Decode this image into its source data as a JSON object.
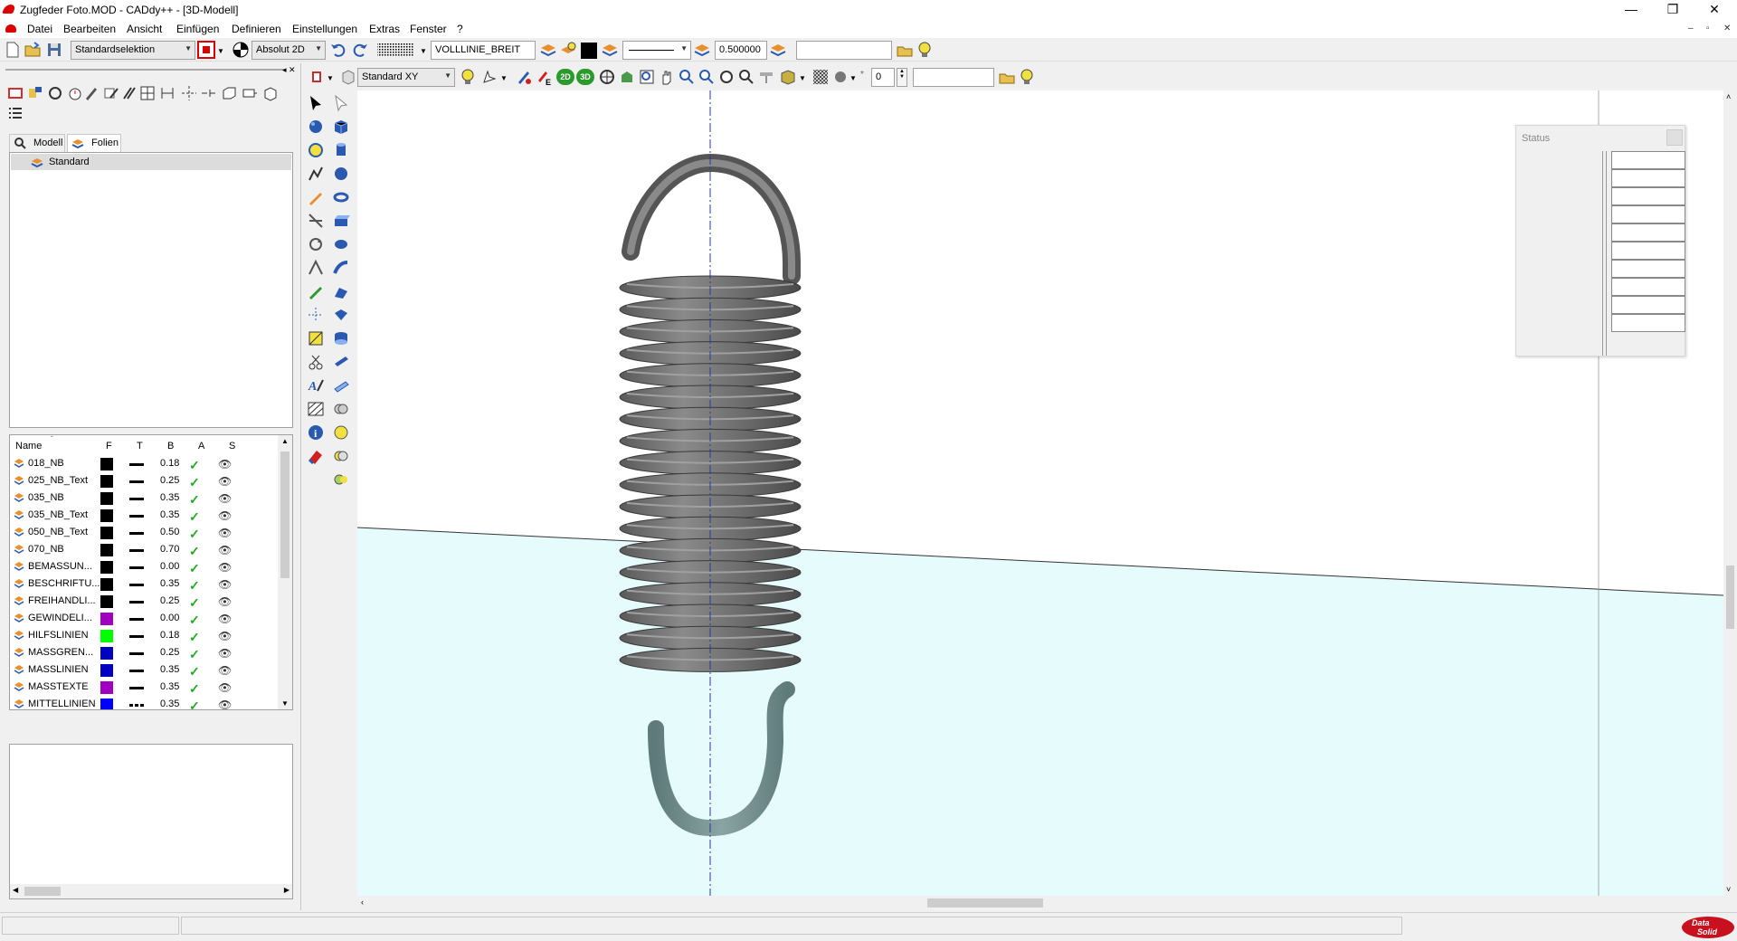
{
  "window": {
    "title": "Zugfeder Foto.MOD  -  CADdy++ - [3D-Modell]",
    "minimize": "—",
    "restore": "❐",
    "close": "✕"
  },
  "menu": [
    "Datei",
    "Bearbeiten",
    "Ansicht",
    "Einfügen",
    "Definieren",
    "Einstellungen",
    "Extras",
    "Fenster",
    "?"
  ],
  "mdi_controls": [
    "–",
    "▫",
    "✕"
  ],
  "toolbar1": {
    "selection_mode": "Standardselektion",
    "coord_mode": "Absolut 2D",
    "linetype": "VOLLLINIE_BREIT",
    "line_width": "0.500000",
    "search_value": ""
  },
  "toolbar2": {
    "view_plane": "Standard XY",
    "layer_number": "0",
    "mode_2d": "2D",
    "mode_3d": "3D",
    "search_value": ""
  },
  "left_panel": {
    "tabs": [
      {
        "label": "Modell",
        "active": false
      },
      {
        "label": "Folien",
        "active": true
      }
    ],
    "folie_selected": "Standard",
    "layer_columns": [
      "Name",
      "F",
      "T",
      "B",
      "A",
      "S"
    ],
    "layers": [
      {
        "name": "018_NB",
        "color": "#000000",
        "width": "0.18",
        "linetype": "solid"
      },
      {
        "name": "025_NB_Text",
        "color": "#000000",
        "width": "0.25",
        "linetype": "solid"
      },
      {
        "name": "035_NB",
        "color": "#000000",
        "width": "0.35",
        "linetype": "solid"
      },
      {
        "name": "035_NB_Text",
        "color": "#000000",
        "width": "0.35",
        "linetype": "solid"
      },
      {
        "name": "050_NB_Text",
        "color": "#000000",
        "width": "0.50",
        "linetype": "solid"
      },
      {
        "name": "070_NB",
        "color": "#000000",
        "width": "0.70",
        "linetype": "solid"
      },
      {
        "name": "BEMASSUN...",
        "color": "#000000",
        "width": "0.00",
        "linetype": "solid"
      },
      {
        "name": "BESCHRIFTU...",
        "color": "#000000",
        "width": "0.35",
        "linetype": "solid"
      },
      {
        "name": "FREIHANDLI...",
        "color": "#000000",
        "width": "0.25",
        "linetype": "solid"
      },
      {
        "name": "GEWINDELI...",
        "color": "#a000c0",
        "width": "0.00",
        "linetype": "solid"
      },
      {
        "name": "HILFSLINIEN",
        "color": "#00ff00",
        "width": "0.18",
        "linetype": "solid"
      },
      {
        "name": "MASSGREN...",
        "color": "#0000c0",
        "width": "0.25",
        "linetype": "solid"
      },
      {
        "name": "MASSLINIEN",
        "color": "#0000c0",
        "width": "0.35",
        "linetype": "solid"
      },
      {
        "name": "MASSTEXTE",
        "color": "#a000c0",
        "width": "0.35",
        "linetype": "solid"
      },
      {
        "name": "MITTELLINIEN",
        "color": "#0000ff",
        "width": "0.35",
        "linetype": "dashdot"
      }
    ]
  },
  "status_window": {
    "title": "Status",
    "rows": [
      "",
      "",
      "",
      "",
      "",
      "",
      "",
      "",
      "",
      ""
    ]
  },
  "colors": {
    "ground_plane": "#e6fbfc",
    "spring": "#6a6a6a",
    "hook_lower": "#6f8a8a",
    "axis_line": "#2a3a9a"
  },
  "brand": "Data Solid"
}
